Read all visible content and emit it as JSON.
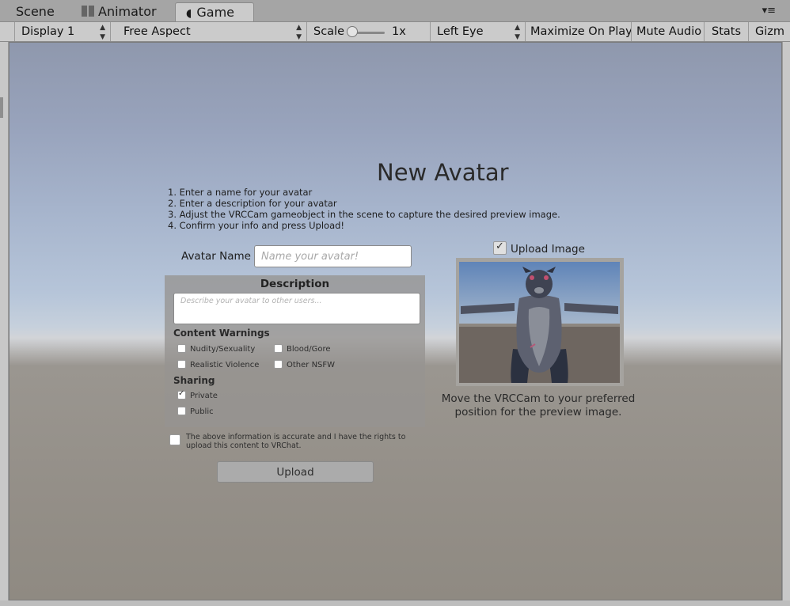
{
  "tabs": {
    "scene": "Scene",
    "animator": "Animator",
    "game": "Game",
    "menu_icon": "panel-menu-icon"
  },
  "toolbar": {
    "display": "Display 1",
    "aspect": "Free Aspect",
    "scale_label": "Scale",
    "scale_value": "1x",
    "eye": "Left Eye",
    "maximize": "Maximize On Play",
    "mute": "Mute Audio",
    "stats": "Stats",
    "gizmos": "Gizm"
  },
  "panel": {
    "title": "New Avatar",
    "instructions": [
      "1. Enter a name for your avatar",
      "2. Enter a description for your avatar",
      "3. Adjust the VRCCam gameobject in the scene to capture the desired preview image.",
      "4. Confirm your info and press Upload!"
    ],
    "name_label": "Avatar Name",
    "name_placeholder": "Name your avatar!",
    "description_heading": "Description",
    "description_placeholder": "Describe your avatar to other users...",
    "content_warnings_label": "Content Warnings",
    "content_warnings": {
      "nudity": "Nudity/Sexuality",
      "blood": "Blood/Gore",
      "violence": "Realistic Violence",
      "nsfw": "Other NSFW"
    },
    "sharing_label": "Sharing",
    "sharing": {
      "private": "Private",
      "public": "Public",
      "selected": "Private"
    },
    "rights_text": "The above information is accurate and I have the rights to upload this content to VRChat.",
    "upload_button": "Upload",
    "upload_image_label": "Upload Image",
    "upload_image_checked": true,
    "caption": "Move the VRCCam to your preferred position for the preview image."
  }
}
